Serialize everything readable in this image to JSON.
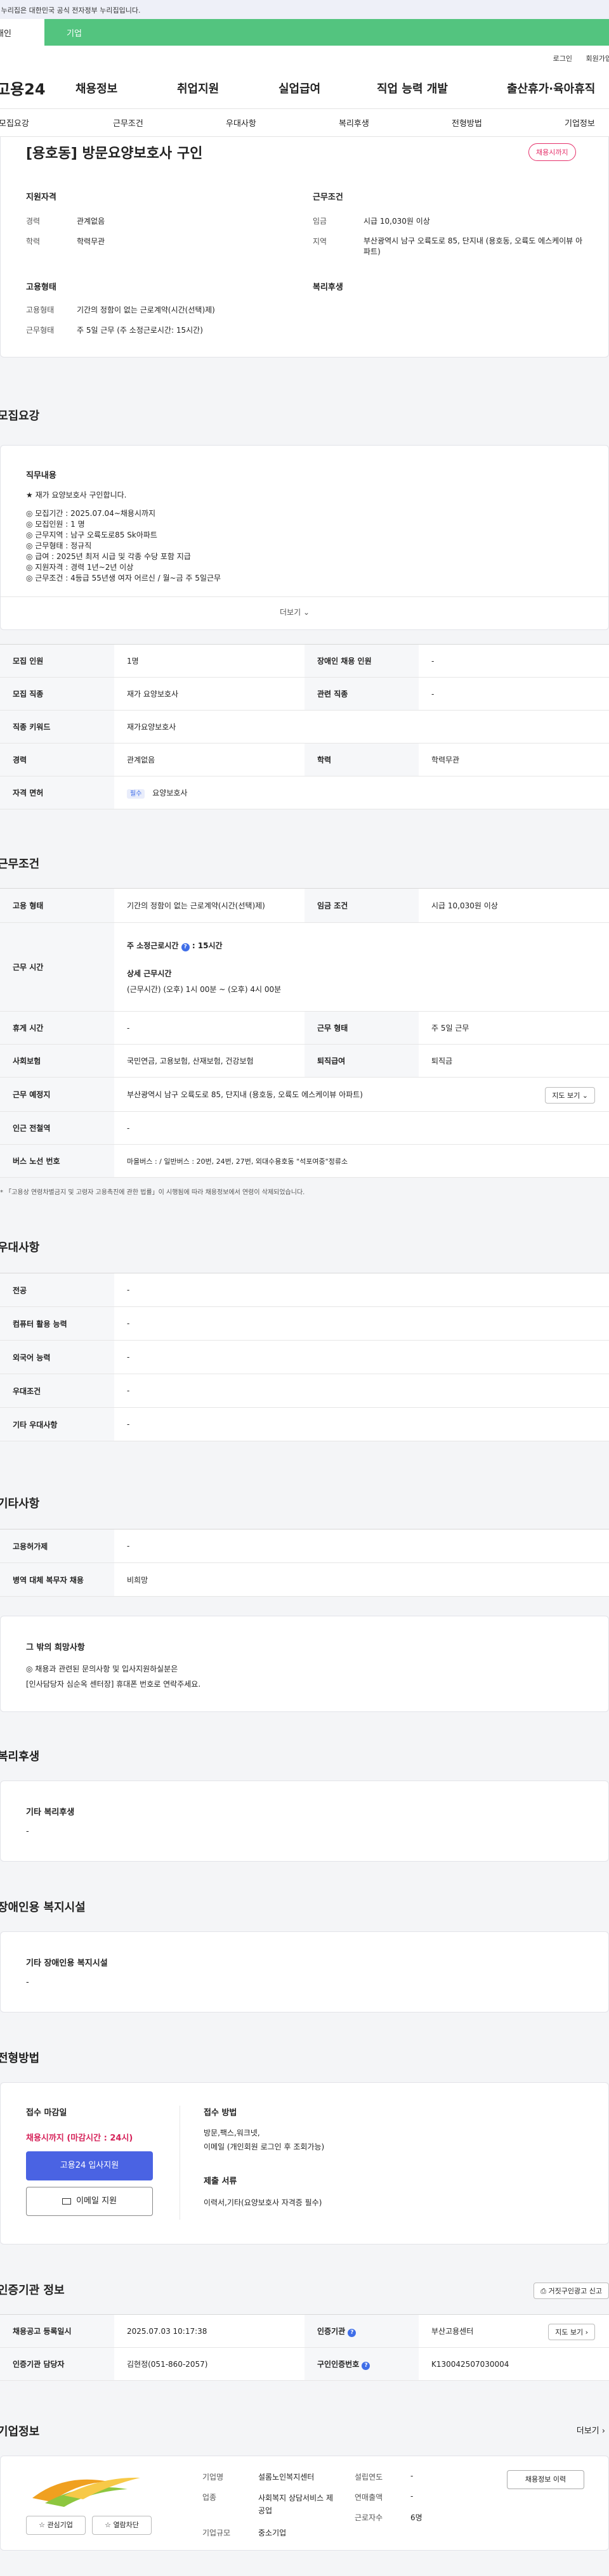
{
  "banner": "이 누리집은 대한민국 공식 전자정부 누리집입니다.",
  "user_tabs": {
    "individual": "개인",
    "corporate": "기업"
  },
  "util": {
    "login": "로그인",
    "signup": "회원가입"
  },
  "gnb": {
    "logo": "고용24",
    "menu": [
      "채용정보",
      "취업지원",
      "실업급여",
      "직업 능력 개발",
      "출산휴가·육아휴직"
    ]
  },
  "subnav": [
    "모집요강",
    "근무조건",
    "우대사항",
    "복리후생",
    "전형방법",
    "기업정보"
  ],
  "summary": {
    "title": "[용호동] 방문요양보호사 구인",
    "badge": "채용시까지",
    "qual_title": "지원자격",
    "qual": [
      {
        "label": "경력",
        "value": "관계없음"
      },
      {
        "label": "학력",
        "value": "학력무관"
      }
    ],
    "cond_title": "근무조건",
    "cond": [
      {
        "label": "임금",
        "value": "시급 10,030원 이상"
      },
      {
        "label": "지역",
        "value": "부산광역시 남구 오륙도로 85, 단지내 (용호동, 오륙도 에스케이뷰 아파트)"
      }
    ],
    "emp_title": "고용형태",
    "emp": [
      {
        "label": "고용형태",
        "value": "기간의 정함이 없는 근로계약(시간(선택)제)"
      },
      {
        "label": "근무형태",
        "value": "주 5일 근무 (주 소정근로시간: 15시간)"
      }
    ],
    "welfare_title": "복리후생"
  },
  "recruit": {
    "section_title": "모집요강",
    "duty_title": "직무내용",
    "duty_lines": [
      "★ 재가 요양보호사 구인합니다.",
      "",
      "◎ 모집기간 : 2025.07.04~채용시까지",
      "◎ 모집인원 : 1 명",
      "◎ 근무지역 : 남구 오륙도로85 Sk아파트",
      "◎ 근무형태 : 정규직",
      "◎ 급여 : 2025년 최저 시급 및 각종 수당 포함 지급",
      "◎ 지원자격 : 경력 1년~2년 이상",
      "◎ 근무조건 : 4등급 55년생 여자 어르신 /   월~금 주 5일근무"
    ],
    "more": "더보기",
    "rows": [
      {
        "h1": "모집 인원",
        "v1": "1명",
        "h2": "장애인 채용 인원",
        "v2": "-"
      },
      {
        "h1": "모집 직종",
        "v1": "재가 요양보호사",
        "h2": "관련 직종",
        "v2": "-"
      },
      {
        "h1": "직종 키워드",
        "v1": "재가요양보호사"
      },
      {
        "h1": "경력",
        "v1": "관계없음",
        "h2": "학력",
        "v2": "학력무관"
      },
      {
        "h1": "자격 면허",
        "tag": "필수",
        "v1": "요양보호사"
      }
    ]
  },
  "work": {
    "section_title": "근무조건",
    "emp_h": "고용 형태",
    "emp_v": "기간의 정함이 없는 근로계약(시간(선택)제)",
    "wage_h": "임금 조건",
    "wage_v": "시급 10,030원 이상",
    "time_h": "근무 시간",
    "time_main": "주 소정근로시간",
    "time_main_v": ": 15시간",
    "time_detail_t": "상세 근무시간",
    "time_detail_v": "(근무시간) (오후) 1시 00분 ~ (오후) 4시 00분",
    "rest_h": "휴게 시간",
    "rest_v": "-",
    "type_h": "근무 형태",
    "type_v": "주 5일 근무",
    "ins_h": "사회보험",
    "ins_v": "국민연금, 고용보험, 산재보험, 건강보험",
    "sev_h": "퇴직급여",
    "sev_v": "퇴직금",
    "place_h": "근무 예정지",
    "place_v": "부산광역시 남구 오륙도로 85, 단지내 (용호동, 오륙도 에스케이뷰 아파트)",
    "map_btn": "지도 보기",
    "sub_h": "인근 전철역",
    "sub_v": "-",
    "bus_h": "버스 노선 번호",
    "bus_v": "마을버스 : / 일반버스 : 20번, 24번, 27번, 외대수용호동 \"석포여중\"정류소",
    "note": "* 「고용상 연령차별금지 및 고령자 고용촉진에 관한 법률」이 시행됨에 따라 채용정보에서 연령이 삭제되었습니다."
  },
  "pref": {
    "section_title": "우대사항",
    "rows": [
      {
        "h": "전공",
        "v": "-"
      },
      {
        "h": "컴퓨터 활용 능력",
        "v": "-"
      },
      {
        "h": "외국어 능력",
        "v": "-"
      },
      {
        "h": "우대조건",
        "v": "-"
      },
      {
        "h": "기타 우대사항",
        "v": "-"
      }
    ]
  },
  "etc": {
    "section_title": "기타사항",
    "rows": [
      {
        "h": "고용허가제",
        "v": "-"
      },
      {
        "h": "병역 대체 복무자 채용",
        "v": "비희망"
      }
    ],
    "hope_title": "그 밖의 희망사항",
    "hope_lines": [
      "◎ 채용과 관련된 문의사항 및 입사지원하실분은",
      "[인사담당자 심순옥 센터장] 휴대폰 번호로 연락주세요."
    ]
  },
  "welfare": {
    "section_title": "복리후생",
    "box_title": "기타 복리후생",
    "box_v": "-"
  },
  "disabled": {
    "section_title": "장애인용 복지시설",
    "box_title": "기타 장애인용 복지시설",
    "box_v": "-"
  },
  "process": {
    "section_title": "전형방법",
    "deadline_title": "접수 마감일",
    "deadline_v": "채용시까지 (마감시간 : 24시)",
    "apply_btn": "고용24 입사지원",
    "email_btn": "이메일 지원",
    "method_title": "접수 방법",
    "method_v1": "방문,팩스,워크넷,",
    "method_v2": "이메일 (개인회원 로그인 후 조회가능)",
    "docs_title": "제출 서류",
    "docs_v": "이력서,기타(요양보호사 자격증 필수)"
  },
  "agency": {
    "section_title": "인증기관 정보",
    "report_btn": "거짓구인광고 신고",
    "reg_h": "채용공고 등록일시",
    "reg_v": "2025.07.03 10:17:38",
    "org_h": "인증기관",
    "org_v": "부산고용센터",
    "map_btn": "지도 보기",
    "staff_h": "인증기관 담당자",
    "staff_v": "김현정(051-860-2057)",
    "cert_h": "구인인증번호",
    "cert_v": "K130042507030004"
  },
  "company": {
    "section_title": "기업정보",
    "more": "더보기",
    "interest_btn": "관심기업",
    "follow_btn": "열람차단",
    "labels": {
      "name": "기업명",
      "industry": "업종",
      "size": "기업규모",
      "founded": "설립연도",
      "sales": "연매출액",
      "employees": "근로자수"
    },
    "name": "설롬노인복지센터",
    "industry": "사회복지 상담서비스 제공업",
    "size": "중소기업",
    "founded": "-",
    "sales": "-",
    "employees": "6명",
    "jobs_btn": "채용정보 이력"
  },
  "colors": {
    "accent": "#3f6ee8",
    "green": "#53c47f",
    "pink": "#e5306a",
    "red_text": "#d6235a"
  }
}
